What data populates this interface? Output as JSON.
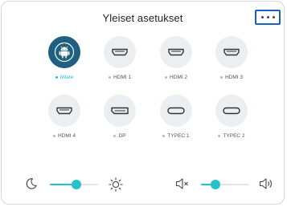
{
  "window": {
    "title": "Yleiset asetukset"
  },
  "header": {
    "more_icon": "more-horizontal-icon",
    "highlight_color": "#1565c0"
  },
  "colors": {
    "accent": "#27c2c9",
    "active_source_bg": "#1f5f82",
    "source_bg": "#eceff1"
  },
  "sources": [
    {
      "label": "iWare",
      "icon": "android-icon",
      "selected": true
    },
    {
      "label": "HDMI 1",
      "icon": "hdmi-port-icon",
      "selected": false
    },
    {
      "label": "HDMI 2",
      "icon": "hdmi-port-icon",
      "selected": false
    },
    {
      "label": "HDMI 3",
      "icon": "hdmi-port-icon",
      "selected": false
    },
    {
      "label": "HDMI 4",
      "icon": "hdmi-port-icon",
      "selected": false
    },
    {
      "label": "DP",
      "icon": "displayport-icon",
      "selected": false
    },
    {
      "label": "TYPEC 1",
      "icon": "usb-c-port-icon",
      "selected": false
    },
    {
      "label": "TYPEC 2",
      "icon": "usb-c-port-icon",
      "selected": false
    }
  ],
  "brightness": {
    "min_icon": "moon-icon",
    "max_icon": "sun-icon",
    "level": 0.55
  },
  "volume": {
    "min_icon": "speaker-mute-icon",
    "max_icon": "speaker-loud-icon",
    "level": 0.3
  }
}
